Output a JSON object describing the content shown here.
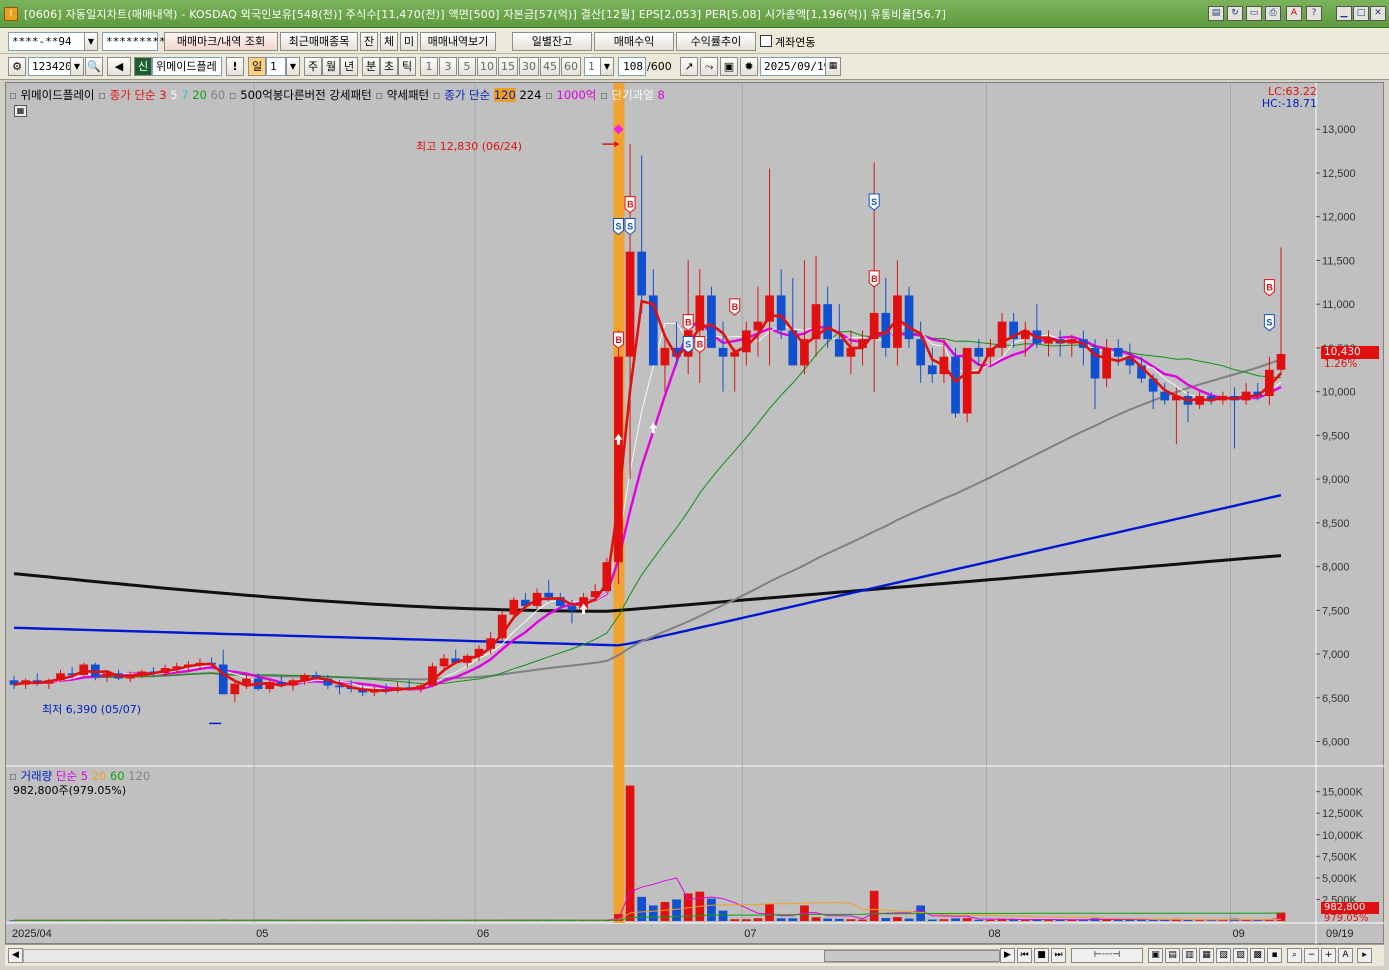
{
  "window": {
    "title": "[0606] 자동일지차트(매매내역) - KOSDAQ 외국인보유[548(천)] 주식수[11,470(천)] 액면[500] 자본금[57(억)] 결산[12월] EPS[2,053] PER[5.08] 시가총액[1,196(억)] 유통비율[56.7]"
  },
  "toolbar1": {
    "account": "****-**94",
    "password": "*********",
    "btn_mark": "매매마크/내역 조회",
    "btn_recent": "최근매매종목",
    "btn_jan": "잔",
    "btn_che": "체",
    "btn_mi": "미",
    "btn_history": "매매내역보기",
    "btn_daily": "일별잔고",
    "btn_profit": "매매수익",
    "btn_return": "수익률추이",
    "link_label": "계좌연동"
  },
  "toolbar2": {
    "code": "123420",
    "sin": "신",
    "name": "위메이드플레",
    "bang": "!",
    "period": "일",
    "period_num": "1",
    "p_week": "주",
    "p_month": "월",
    "p_year": "년",
    "p_min": "분",
    "p_sec": "초",
    "p_tick": "틱",
    "n1": "1",
    "n3": "3",
    "n5": "5",
    "n10": "10",
    "n15": "15",
    "n30": "30",
    "n45": "45",
    "n60": "60",
    "sel_num": "1",
    "count": "108",
    "count_max": "/600",
    "date": "2025/09/19"
  },
  "legend": {
    "name": "위메이드플레이",
    "ma_label": "종가 단순",
    "ma3": "3",
    "ma5": "5",
    "ma7": "7",
    "ma20": "20",
    "ma60": "60",
    "pattern1": "500억봉다른버전 강세패턴",
    "pattern2": "약세패턴",
    "ma_label2": "종가 단순",
    "ma120": "120",
    "ma224": "224",
    "k1000": "1000억",
    "short_over": "단기과열",
    "short_val": "8"
  },
  "chart_data": {
    "type": "candlestick",
    "y_axis": [
      "13,000",
      "12,500",
      "12,000",
      "11,500",
      "11,000",
      "10,500",
      "10,000",
      "9,500",
      "9,000",
      "8,500",
      "8,000",
      "7,500",
      "7,000",
      "6,500",
      "6,000"
    ],
    "ylim": [
      5800,
      13300
    ],
    "x_labels": [
      "2025/04",
      "05",
      "06",
      "07",
      "08",
      "09",
      "09/19"
    ],
    "high_annotation": "최고 12,830 (06/24)",
    "low_annotation": "최저 6,390 (05/07)",
    "lc": "LC:63.22",
    "hc": "HC:-18.71",
    "last_price": "10,430",
    "last_change": "1.26%",
    "volume": {
      "legend_title": "거래량",
      "ma_label": "단순",
      "ma5": "5",
      "ma20": "20",
      "ma60": "60",
      "ma120": "120",
      "current": "982,800주(979.05%)",
      "y_axis": [
        "15,000K",
        "12,500K",
        "10,000K",
        "7,500K",
        "5,000K",
        "2,500K"
      ],
      "last_vol": "982,800",
      "last_pct": "979.05%"
    },
    "candles": [
      [
        6700,
        6750,
        6600,
        6650
      ],
      [
        6650,
        6720,
        6600,
        6700
      ],
      [
        6700,
        6780,
        6640,
        6660
      ],
      [
        6660,
        6720,
        6600,
        6700
      ],
      [
        6700,
        6820,
        6680,
        6780
      ],
      [
        6780,
        6850,
        6720,
        6760
      ],
      [
        6760,
        6900,
        6740,
        6880
      ],
      [
        6880,
        6900,
        6700,
        6740
      ],
      [
        6740,
        6800,
        6680,
        6780
      ],
      [
        6780,
        6820,
        6700,
        6720
      ],
      [
        6720,
        6800,
        6680,
        6760
      ],
      [
        6760,
        6820,
        6720,
        6800
      ],
      [
        6800,
        6850,
        6740,
        6780
      ],
      [
        6780,
        6880,
        6750,
        6840
      ],
      [
        6840,
        6900,
        6780,
        6860
      ],
      [
        6860,
        6920,
        6800,
        6880
      ],
      [
        6880,
        6950,
        6820,
        6900
      ],
      [
        6900,
        6960,
        6850,
        6880
      ],
      [
        6880,
        7050,
        6600,
        6540
      ],
      [
        6540,
        6700,
        6450,
        6660
      ],
      [
        6660,
        6760,
        6600,
        6720
      ],
      [
        6720,
        6780,
        6580,
        6600
      ],
      [
        6600,
        6700,
        6560,
        6680
      ],
      [
        6680,
        6750,
        6620,
        6640
      ],
      [
        6640,
        6720,
        6580,
        6700
      ],
      [
        6700,
        6780,
        6650,
        6760
      ],
      [
        6760,
        6800,
        6700,
        6720
      ],
      [
        6720,
        6760,
        6600,
        6640
      ],
      [
        6640,
        6700,
        6540,
        6620
      ],
      [
        6620,
        6700,
        6560,
        6600
      ],
      [
        6600,
        6640,
        6520,
        6560
      ],
      [
        6560,
        6640,
        6520,
        6600
      ],
      [
        6600,
        6660,
        6540,
        6580
      ],
      [
        6580,
        6680,
        6560,
        6620
      ],
      [
        6620,
        6700,
        6580,
        6600
      ],
      [
        6600,
        6660,
        6560,
        6640
      ],
      [
        6640,
        6900,
        6620,
        6860
      ],
      [
        6860,
        7000,
        6800,
        6950
      ],
      [
        6950,
        7050,
        6880,
        6900
      ],
      [
        6900,
        7000,
        6850,
        6980
      ],
      [
        6980,
        7100,
        6920,
        7060
      ],
      [
        7060,
        7250,
        7000,
        7180
      ],
      [
        7180,
        7500,
        7150,
        7450
      ],
      [
        7450,
        7650,
        7400,
        7620
      ],
      [
        7620,
        7700,
        7500,
        7550
      ],
      [
        7550,
        7750,
        7520,
        7700
      ],
      [
        7700,
        7850,
        7600,
        7650
      ],
      [
        7650,
        7700,
        7500,
        7550
      ],
      [
        7550,
        7620,
        7350,
        7500
      ],
      [
        7500,
        7700,
        7450,
        7650
      ],
      [
        7650,
        7800,
        7600,
        7720
      ],
      [
        7720,
        8100,
        7700,
        8050
      ],
      [
        8050,
        10700,
        7800,
        10400
      ],
      [
        10400,
        12830,
        9000,
        11600
      ],
      [
        11600,
        12700,
        10900,
        11100
      ],
      [
        11100,
        11400,
        10300,
        10300
      ],
      [
        10300,
        10600,
        10000,
        10500
      ],
      [
        10500,
        10800,
        10300,
        10400
      ],
      [
        10400,
        11500,
        10200,
        10700
      ],
      [
        10700,
        11400,
        10100,
        11100
      ],
      [
        11100,
        11200,
        10500,
        10500
      ],
      [
        10500,
        10800,
        10000,
        10400
      ],
      [
        10400,
        10500,
        10000,
        10450
      ],
      [
        10450,
        10800,
        10300,
        10700
      ],
      [
        10700,
        11200,
        10400,
        10800
      ],
      [
        10800,
        12550,
        10300,
        11100
      ],
      [
        11100,
        11400,
        10600,
        10700
      ],
      [
        10700,
        11300,
        10500,
        10300
      ],
      [
        10300,
        11500,
        10200,
        10600
      ],
      [
        10600,
        11550,
        10400,
        11000
      ],
      [
        11000,
        11200,
        10500,
        10600
      ],
      [
        10600,
        11000,
        10400,
        10400
      ],
      [
        10400,
        10700,
        10200,
        10500
      ],
      [
        10500,
        10700,
        10300,
        10600
      ],
      [
        10600,
        12620,
        10000,
        10900
      ],
      [
        10900,
        11300,
        10400,
        10500
      ],
      [
        10500,
        11500,
        10300,
        11100
      ],
      [
        11100,
        11200,
        10500,
        10600
      ],
      [
        10600,
        10800,
        10100,
        10300
      ],
      [
        10300,
        10500,
        10100,
        10200
      ],
      [
        10200,
        10600,
        10100,
        10400
      ],
      [
        10400,
        10500,
        9700,
        9750
      ],
      [
        9750,
        10500,
        9650,
        10500
      ],
      [
        10500,
        10600,
        10300,
        10400
      ],
      [
        10400,
        10600,
        10300,
        10500
      ],
      [
        10500,
        10900,
        10400,
        10800
      ],
      [
        10800,
        10900,
        10500,
        10600
      ],
      [
        10600,
        10800,
        10400,
        10700
      ],
      [
        10700,
        11000,
        10500,
        10550
      ],
      [
        10550,
        10700,
        10400,
        10600
      ],
      [
        10600,
        10700,
        10400,
        10550
      ],
      [
        10550,
        10650,
        10400,
        10600
      ],
      [
        10600,
        10700,
        10300,
        10500
      ],
      [
        10500,
        10600,
        9800,
        10150
      ],
      [
        10150,
        10600,
        10050,
        10500
      ],
      [
        10500,
        10600,
        10300,
        10400
      ],
      [
        10400,
        10550,
        10200,
        10300
      ],
      [
        10300,
        10400,
        10100,
        10150
      ],
      [
        10150,
        10200,
        9800,
        10000
      ],
      [
        10000,
        10100,
        9850,
        9900
      ],
      [
        9900,
        10050,
        9400,
        9950
      ],
      [
        9950,
        10000,
        9650,
        9850
      ],
      [
        9850,
        10000,
        9800,
        9950
      ],
      [
        9950,
        10000,
        9850,
        9900
      ],
      [
        9900,
        10000,
        9850,
        9950
      ],
      [
        9950,
        10050,
        9350,
        9900
      ],
      [
        9900,
        10100,
        9850,
        10000
      ],
      [
        10000,
        10100,
        9900,
        9950
      ],
      [
        9950,
        10400,
        9850,
        10250
      ],
      [
        10250,
        11650,
        10200,
        10430
      ]
    ]
  },
  "scrollbar": {
    "zoom_out": "−",
    "zoom_in": "+",
    "font": "A"
  }
}
